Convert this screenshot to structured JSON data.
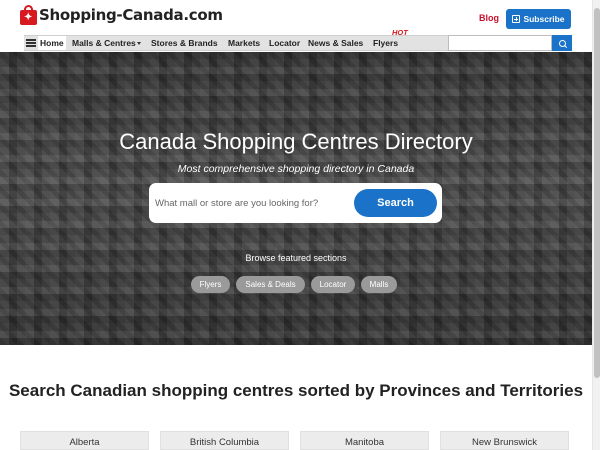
{
  "header": {
    "logo_text": "Shopping-Canada.com",
    "blog_label": "Blog",
    "subscribe_label": "Subscribe"
  },
  "nav": {
    "items": [
      {
        "label": "Home",
        "active": true
      },
      {
        "label": "Malls & Centres",
        "has_dropdown": true
      },
      {
        "label": "Stores & Brands"
      },
      {
        "label": "Markets"
      },
      {
        "label": "Locator"
      },
      {
        "label": "News & Sales"
      },
      {
        "label": "Flyers"
      }
    ],
    "hot_badge": "HOT",
    "search_placeholder": ""
  },
  "hero": {
    "title": "Canada Shopping Centres Directory",
    "subtitle": "Most comprehensive shopping directory in Canada",
    "search_placeholder": "What mall or store are you looking for?",
    "search_button": "Search",
    "browse_label": "Browse featured sections",
    "pills": [
      "Flyers",
      "Sales & Deals",
      "Locator",
      "Malls"
    ]
  },
  "provinces": {
    "title": "Search Canadian shopping centres sorted by Provinces and Territories",
    "items": [
      "Alberta",
      "British Columbia",
      "Manitoba",
      "New Brunswick"
    ]
  },
  "colors": {
    "brand_red": "#d71920",
    "primary_blue": "#1a73c8",
    "nav_bg": "#e2e2e2"
  },
  "icons": {
    "logo": "shopping-bag-maple-leaf-icon",
    "subscribe": "plus-square-icon",
    "search": "search-icon",
    "menu": "hamburger-menu-icon"
  }
}
